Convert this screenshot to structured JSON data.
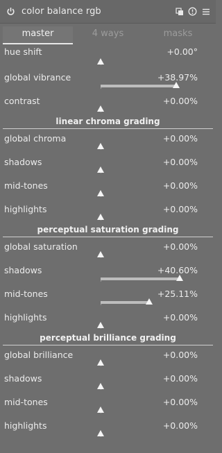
{
  "module": {
    "title": "color balance rgb"
  },
  "tabs": [
    {
      "label": "master",
      "active": true
    },
    {
      "label": "4 ways",
      "active": false
    },
    {
      "label": "masks",
      "active": false
    }
  ],
  "hue_shift": {
    "label": "hue shift",
    "value": "+0.00°",
    "level": 0
  },
  "global_vibrance": {
    "label": "global vibrance",
    "value": "+38.97%",
    "level": 0.3897
  },
  "contrast": {
    "label": "contrast",
    "value": "+0.00%",
    "level": 0
  },
  "linear": {
    "title": "linear chroma grading",
    "rows": [
      {
        "label": "global chroma",
        "value": "+0.00%",
        "level": 0
      },
      {
        "label": "shadows",
        "value": "+0.00%",
        "level": 0
      },
      {
        "label": "mid-tones",
        "value": "+0.00%",
        "level": 0
      },
      {
        "label": "highlights",
        "value": "+0.00%",
        "level": 0
      }
    ]
  },
  "perceptual_sat": {
    "title": "perceptual saturation grading",
    "rows": [
      {
        "label": "global saturation",
        "value": "+0.00%",
        "level": 0
      },
      {
        "label": "shadows",
        "value": "+40.60%",
        "level": 0.406
      },
      {
        "label": "mid-tones",
        "value": "+25.11%",
        "level": 0.2511
      },
      {
        "label": "highlights",
        "value": "+0.00%",
        "level": 0
      }
    ]
  },
  "perceptual_bri": {
    "title": "perceptual brilliance grading",
    "rows": [
      {
        "label": "global brilliance",
        "value": "+0.00%",
        "level": 0
      },
      {
        "label": "shadows",
        "value": "+0.00%",
        "level": 0
      },
      {
        "label": "mid-tones",
        "value": "+0.00%",
        "level": 0
      },
      {
        "label": "highlights",
        "value": "+0.00%",
        "level": 0
      }
    ]
  },
  "icons": [
    "power-icon",
    "presets-icon",
    "reset-icon",
    "menu-icon"
  ]
}
